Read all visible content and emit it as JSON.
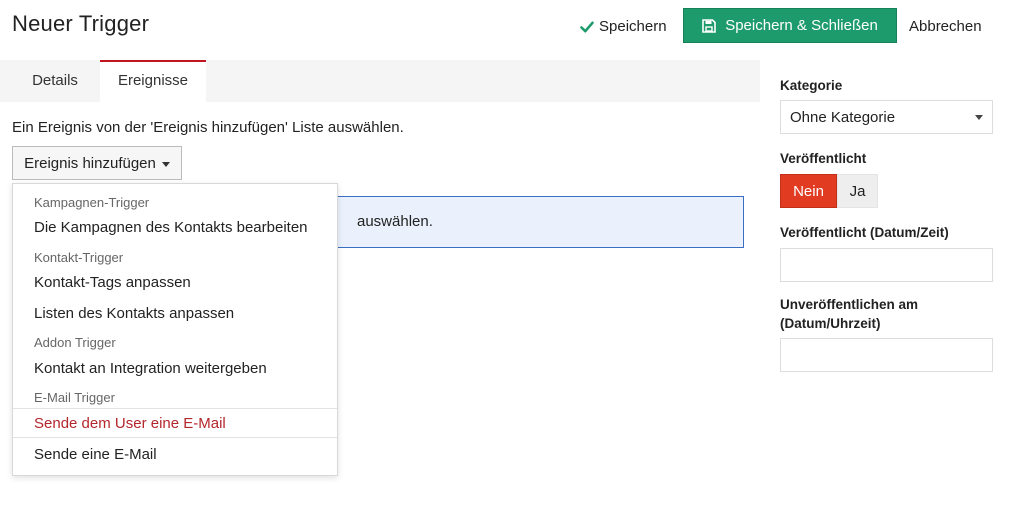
{
  "header": {
    "title": "Neuer Trigger",
    "save_label": "Speichern",
    "save_close_label": "Speichern & Schließen",
    "cancel_label": "Abbrechen"
  },
  "tabs": [
    {
      "label": "Details"
    },
    {
      "label": "Ereignisse"
    }
  ],
  "main": {
    "instruction": "Ein Ereignis von der 'Ereignis hinzufügen' Liste auswählen.",
    "add_event_label": "Ereignis hinzufügen",
    "info_text": "auswählen."
  },
  "dropdown": {
    "groups": [
      {
        "header": "Kampagnen-Trigger",
        "items": [
          "Die Kampagnen des Kontakts bearbeiten"
        ]
      },
      {
        "header": "Kontakt-Trigger",
        "items": [
          "Kontakt-Tags anpassen",
          "Listen des Kontakts anpassen"
        ]
      },
      {
        "header": "Addon Trigger",
        "items": [
          "Kontakt an Integration weitergeben"
        ]
      },
      {
        "header": "E-Mail Trigger",
        "items": [
          "Sende dem User eine E-Mail",
          "Sende eine E-Mail"
        ]
      }
    ],
    "active_item": "Sende dem User eine E-Mail"
  },
  "sidebar": {
    "category_label": "Kategorie",
    "category_value": "Ohne Kategorie",
    "published_label": "Veröffentlicht",
    "published_no": "Nein",
    "published_yes": "Ja",
    "published_selected": "Nein",
    "publish_date_label": "Veröffentlicht (Datum/Zeit)",
    "publish_date_value": "",
    "unpublish_label_line1": "Unveröffentlichen am",
    "unpublish_label_line2": "(Datum/Uhrzeit)",
    "unpublish_date_value": ""
  },
  "colors": {
    "primary_green": "#1e9b6c",
    "danger_red": "#e13b22",
    "tab_accent": "#c0161f",
    "active_item_text": "#b3262c",
    "info_bg": "#eaf1fc",
    "info_border": "#3a6fc2"
  },
  "icons": {
    "save": "check-icon",
    "save_close": "floppy-disk-icon",
    "dropdown": "caret-down-icon"
  }
}
